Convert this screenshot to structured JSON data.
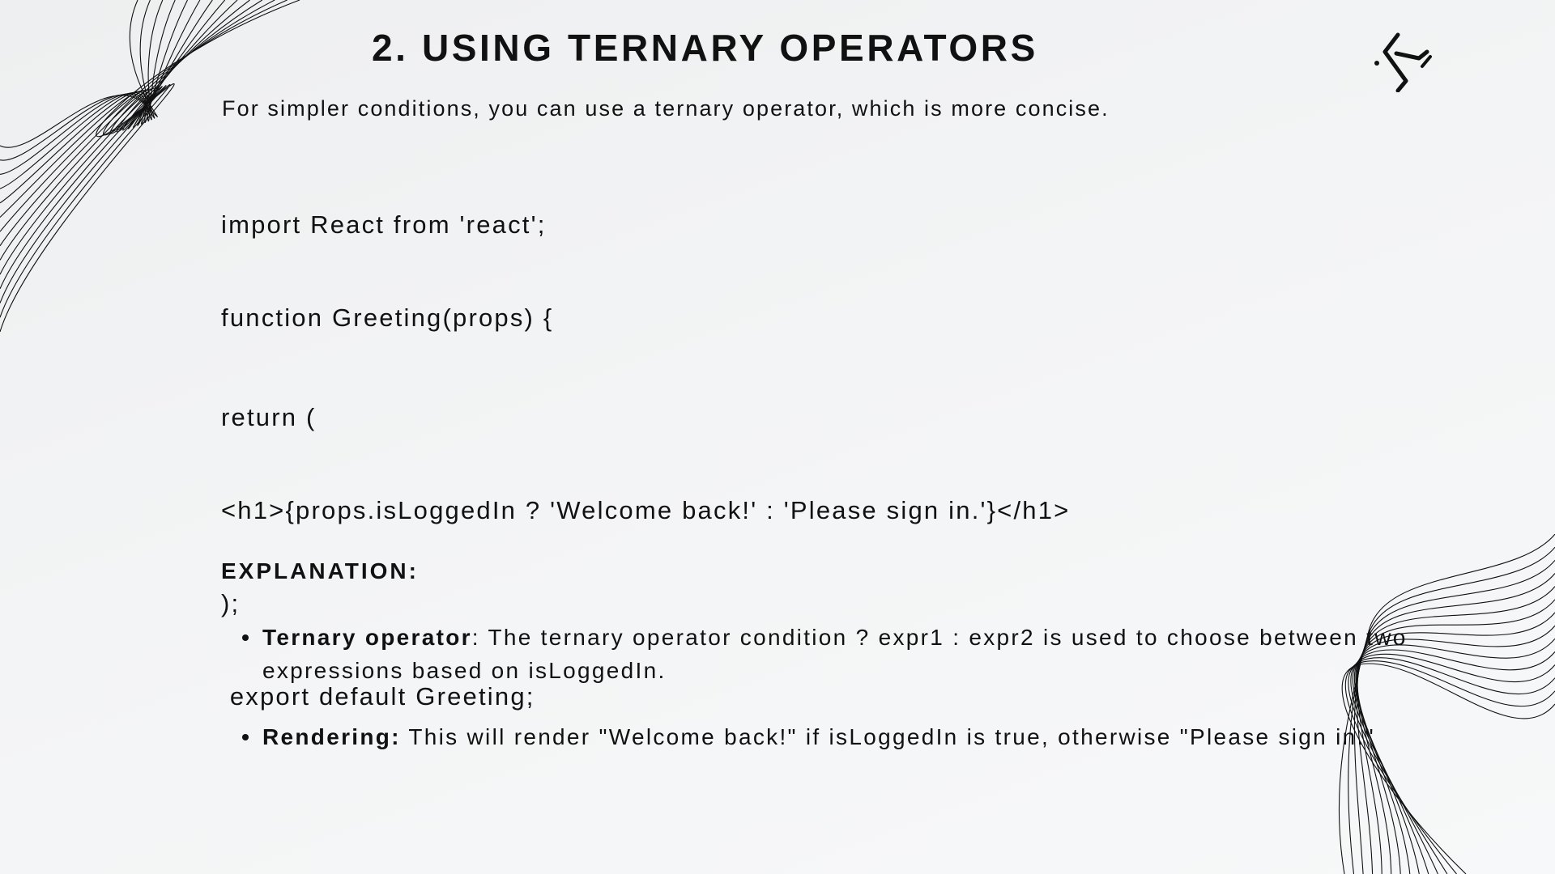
{
  "slide": {
    "title": "2. USING TERNARY OPERATORS",
    "intro": "For simpler conditions, you can use a ternary operator, which is more concise."
  },
  "code": {
    "lines": [
      "import React from 'react';",
      "function Greeting(props) {",
      "return (",
      "<h1>{props.isLoggedIn ? 'Welcome back!' : 'Please sign in.'}</h1>",
      ");",
      " export default Greeting;"
    ]
  },
  "explanation": {
    "heading": "EXPLANATION:",
    "items": [
      {
        "term": "Ternary operator",
        "text": ": The ternary operator condition ? expr1 : expr2 is used to choose between two expressions based on isLoggedIn."
      },
      {
        "term": "Rendering:",
        "text": " This will render \"Welcome back!\" if isLoggedIn is true, otherwise \"Please sign in.\""
      }
    ]
  },
  "decorations": {
    "logo_icon": "brand-logo-icon",
    "wave_icon": "line-wave-decoration",
    "ink_color": "#111111",
    "background_color": "#f3f4f5"
  }
}
